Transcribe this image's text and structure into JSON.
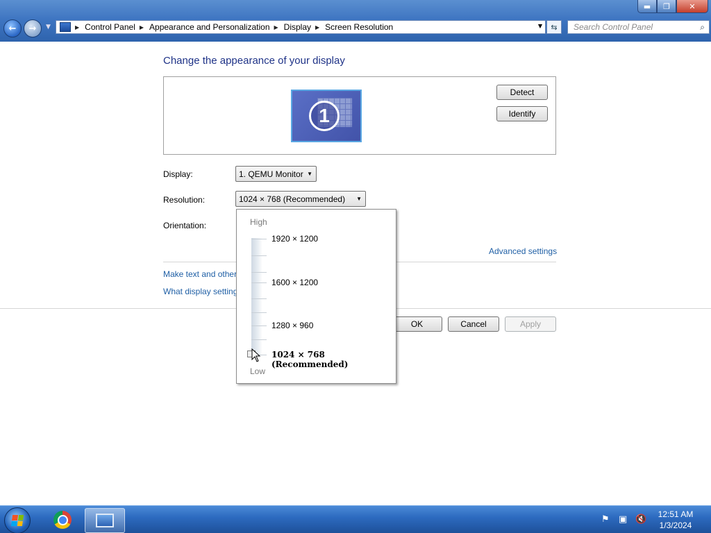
{
  "window": {
    "title_buttons": {
      "minimize": "▬",
      "maximize": "❐",
      "close": "✕"
    },
    "nav": {
      "back_icon": "arrow-left",
      "forward_icon": "arrow-right"
    },
    "breadcrumbs": [
      "Control Panel",
      "Appearance and Personalization",
      "Display",
      "Screen Resolution"
    ],
    "search_placeholder": "Search Control Panel"
  },
  "main": {
    "heading": "Change the appearance of your display",
    "monitor_number": "1",
    "detect_label": "Detect",
    "identify_label": "Identify",
    "display_label": "Display:",
    "display_value": "1. QEMU Monitor",
    "resolution_label": "Resolution:",
    "resolution_value": "1024 × 768 (Recommended)",
    "orientation_label": "Orientation:",
    "advanced_link": "Advanced settings",
    "link_text_size": "Make text and other",
    "link_what_settings": "What display setting",
    "ok_label": "OK",
    "cancel_label": "Cancel",
    "apply_label": "Apply"
  },
  "resolution_popup": {
    "high_label": "High",
    "low_label": "Low",
    "options": [
      "1920 × 1200",
      "1600 × 1200",
      "1280 × 960",
      "1024 × 768 (Recommended)"
    ],
    "selected_index": 3
  },
  "taskbar": {
    "time": "12:51 AM",
    "date": "1/3/2024",
    "apps": [
      "chrome-icon",
      "control-panel-icon"
    ]
  },
  "colors": {
    "heading": "#1e3287",
    "link": "#1f5fa5",
    "taskbar": "#2d6bc0"
  }
}
